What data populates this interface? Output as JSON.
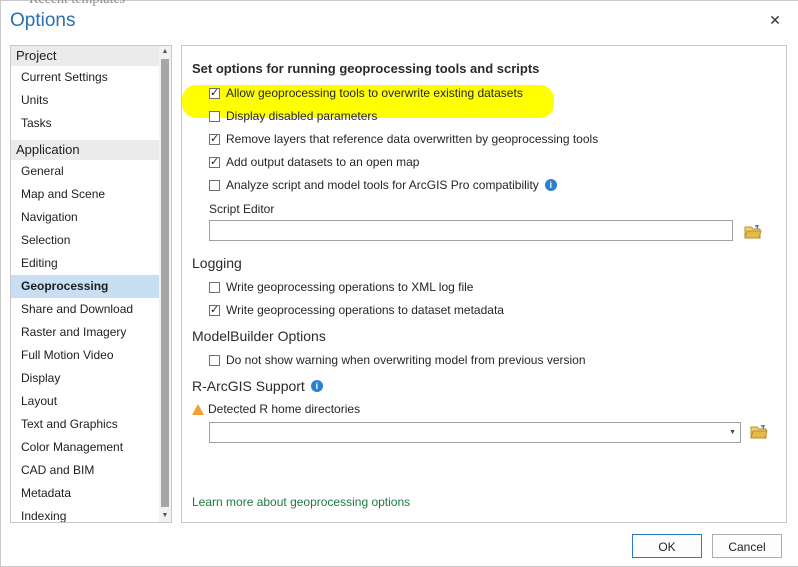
{
  "window": {
    "background_text": "Recent templates",
    "title": "Options",
    "close_glyph": "✕"
  },
  "nav": {
    "groups": [
      {
        "label": "Project",
        "items": [
          "Current Settings",
          "Units",
          "Tasks"
        ]
      },
      {
        "label": "Application",
        "items": [
          "General",
          "Map and Scene",
          "Navigation",
          "Selection",
          "Editing",
          "Geoprocessing",
          "Share and Download",
          "Raster and Imagery",
          "Full Motion Video",
          "Display",
          "Layout",
          "Text and Graphics",
          "Color Management",
          "CAD and BIM",
          "Metadata",
          "Indexing"
        ]
      }
    ],
    "selected": "Geoprocessing"
  },
  "panel": {
    "main_header": "Set options for running geoprocessing tools and scripts",
    "options": [
      {
        "label": "Allow geoprocessing tools to overwrite existing datasets",
        "checked": true
      },
      {
        "label": "Display disabled parameters",
        "checked": false
      },
      {
        "label": "Remove layers that reference data overwritten by geoprocessing tools",
        "checked": true
      },
      {
        "label": "Add output datasets to an open map",
        "checked": true
      },
      {
        "label": "Analyze script and model tools for ArcGIS Pro compatibility",
        "checked": false
      }
    ],
    "script_editor_label": "Script Editor",
    "script_editor_value": "",
    "logging_header": "Logging",
    "logging": [
      {
        "label": "Write geoprocessing operations to XML log file",
        "checked": false
      },
      {
        "label": "Write geoprocessing operations to dataset metadata",
        "checked": true
      }
    ],
    "modelbuilder_header": "ModelBuilder Options",
    "modelbuilder": [
      {
        "label": "Do not show warning when overwriting model from previous version",
        "checked": false
      }
    ],
    "r_header": "R-ArcGIS Support",
    "r_detected_label": "Detected R home directories",
    "r_dropdown_value": "",
    "learn_more": "Learn more about geoprocessing options",
    "info_glyph": "i",
    "highlight_color": "#ffff00"
  },
  "buttons": {
    "ok": "OK",
    "cancel": "Cancel"
  },
  "icons": {
    "folder_color": "#e8b84a",
    "info_color": "#2d7fd1",
    "warning_color": "#f0a030"
  }
}
